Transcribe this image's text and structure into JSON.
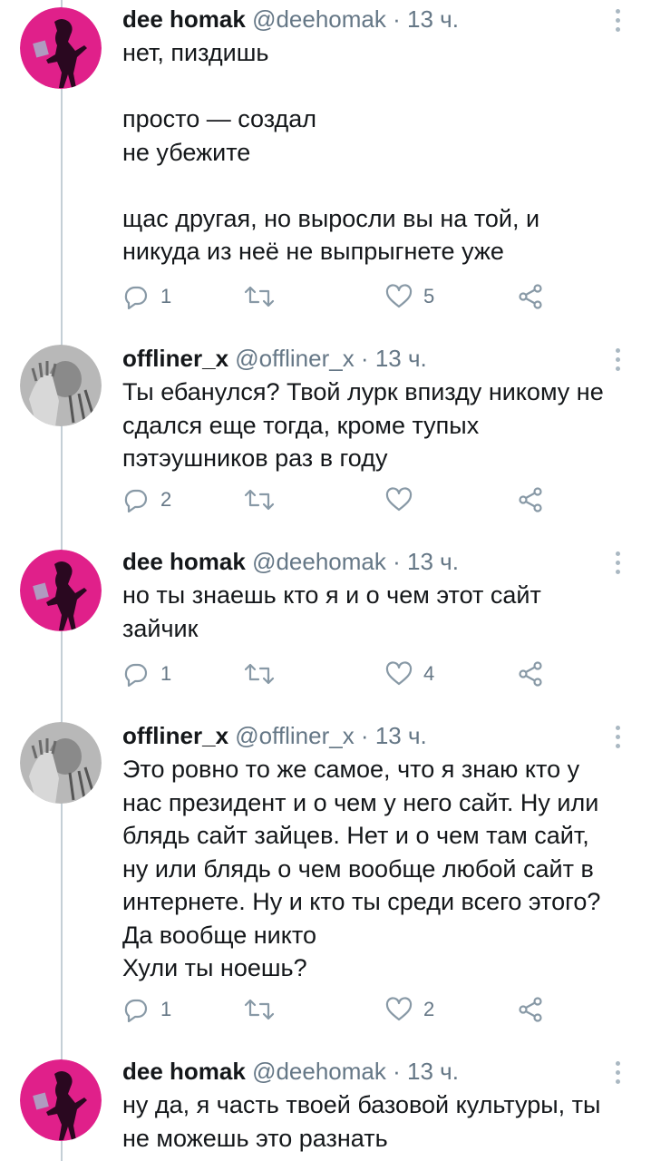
{
  "tweets": [
    {
      "name": "dee homak",
      "handle": "@deehomak",
      "sep": "·",
      "time": "13 ч.",
      "lines": [
        "нет, пиздишь",
        "",
        "просто — создал",
        "не убежите",
        "",
        "щас другая, но выросли вы на той, и",
        "никуда из неё не выпрыгнете уже"
      ],
      "reply_count": "1",
      "retweet_count": "",
      "like_count": "5"
    },
    {
      "name": "offliner_x",
      "handle": "@offliner_x",
      "sep": "·",
      "time": "13 ч.",
      "lines": [
        "Ты ебанулся? Твой лурк впизду никому не",
        "сдался еще тогда, кроме тупых",
        "пэтэушников раз в году"
      ],
      "reply_count": "2",
      "retweet_count": "",
      "like_count": ""
    },
    {
      "name": "dee homak",
      "handle": "@deehomak",
      "sep": "·",
      "time": "13 ч.",
      "lines": [
        "но ты знаешь кто я и о чем этот сайт",
        "зайчик"
      ],
      "reply_count": "1",
      "retweet_count": "",
      "like_count": "4"
    },
    {
      "name": "offliner_x",
      "handle": "@offliner_x",
      "sep": "·",
      "time": "13 ч.",
      "lines": [
        "Это ровно то же самое, что я знаю кто у",
        "нас президент и о чем у него сайт. Ну или",
        "блядь сайт зайцев. Нет и о чем там сайт,",
        "ну или блядь о чем вообще любой сайт в",
        "интернете. Ну и кто ты среди всего этого?",
        "Да вообще никто",
        "Хули ты ноешь?"
      ],
      "reply_count": "1",
      "retweet_count": "",
      "like_count": "2"
    },
    {
      "name": "dee homak",
      "handle": "@deehomak",
      "sep": "·",
      "time": "13 ч.",
      "lines": [
        "ну да, я часть твоей базовой культуры, ты",
        "не можешь это разнать"
      ],
      "reply_count": "",
      "retweet_count": "",
      "like_count": ""
    }
  ],
  "icons": {
    "reply": "reply-icon",
    "retweet": "retweet-icon",
    "like": "heart-icon",
    "share": "share-icon",
    "more": "more-options-icon"
  },
  "colors": {
    "text": "#14171a",
    "muted": "#657786",
    "icon": "#8899a6",
    "thread_line": "#c4cfd6",
    "avatar_pink": "#e0208a"
  }
}
